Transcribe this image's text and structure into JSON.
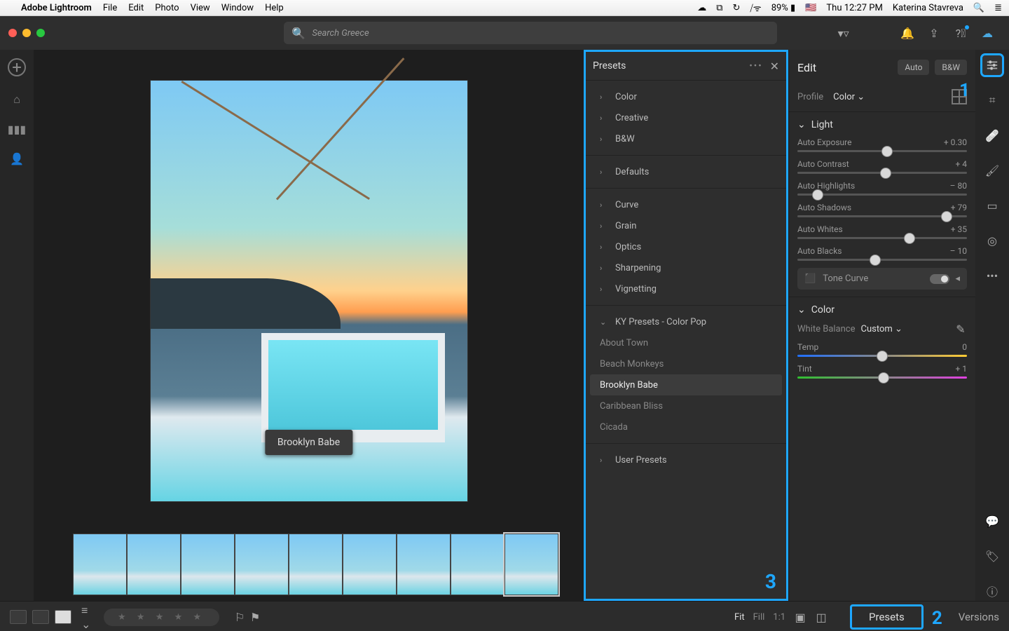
{
  "menubar": {
    "app": "Adobe Lightroom",
    "items": [
      "File",
      "Edit",
      "Photo",
      "View",
      "Window",
      "Help"
    ],
    "battery": "89%",
    "time": "Thu 12:27 PM",
    "user": "Katerina Stavreva"
  },
  "search": {
    "placeholder": "Search Greece"
  },
  "presets": {
    "title": "Presets",
    "groups1": [
      "Color",
      "Creative",
      "B&W"
    ],
    "groups2": [
      "Defaults"
    ],
    "groups3": [
      "Curve",
      "Grain",
      "Optics",
      "Sharpening",
      "Vignetting"
    ],
    "expanded_title": "KY Presets - Color Pop",
    "expanded_items": [
      "About Town",
      "Beach Monkeys",
      "Brooklyn Babe",
      "Caribbean Bliss",
      "Cicada"
    ],
    "selected": "Brooklyn Babe",
    "groups4": [
      "User Presets"
    ]
  },
  "edit": {
    "title": "Edit",
    "btn_auto": "Auto",
    "btn_bw": "B&W",
    "profile_label": "Profile",
    "profile_value": "Color",
    "light": {
      "title": "Light",
      "sliders": [
        {
          "name": "Auto Exposure",
          "value": "+ 0.30",
          "pos": 53
        },
        {
          "name": "Auto Contrast",
          "value": "+ 4",
          "pos": 52
        },
        {
          "name": "Auto Highlights",
          "value": "– 80",
          "pos": 12
        },
        {
          "name": "Auto Shadows",
          "value": "+ 79",
          "pos": 88
        },
        {
          "name": "Auto Whites",
          "value": "+ 35",
          "pos": 66
        },
        {
          "name": "Auto Blacks",
          "value": "– 10",
          "pos": 46
        }
      ],
      "tone_curve": "Tone Curve"
    },
    "color": {
      "title": "Color",
      "wb_label": "White Balance",
      "wb_value": "Custom",
      "temp": {
        "name": "Temp",
        "value": "0",
        "pos": 50
      },
      "tint": {
        "name": "Tint",
        "value": "+ 1",
        "pos": 51
      }
    }
  },
  "tooltip": "Brooklyn Babe",
  "bottom": {
    "fit": "Fit",
    "fill": "Fill",
    "ratio": "1:1",
    "presets": "Presets",
    "versions": "Versions"
  },
  "annotations": {
    "n1": "1",
    "n2": "2",
    "n3": "3"
  }
}
